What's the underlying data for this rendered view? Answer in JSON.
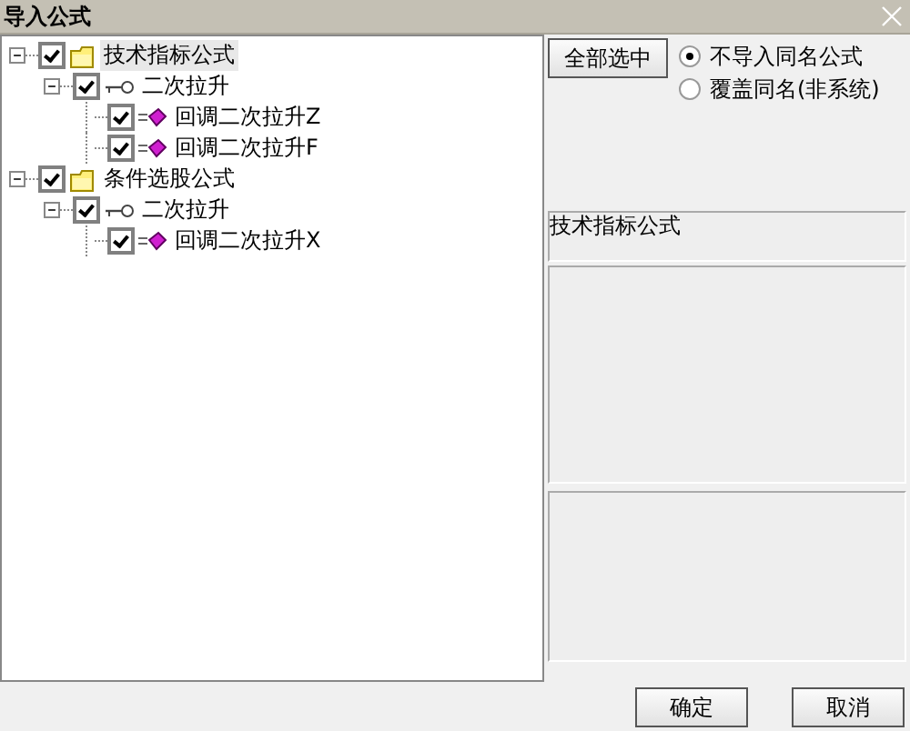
{
  "window": {
    "title": "导入公式"
  },
  "tree": [
    {
      "label": "技术指标公式",
      "kind": "folder",
      "checked": true,
      "expanded": true,
      "selected": true,
      "children": [
        {
          "label": "二次拉升",
          "kind": "group",
          "checked": true,
          "expanded": true,
          "selected": false,
          "children": [
            {
              "label": "回调二次拉升Z",
              "kind": "formula",
              "checked": true,
              "selected": false
            },
            {
              "label": "回调二次拉升F",
              "kind": "formula",
              "checked": true,
              "selected": false
            }
          ]
        }
      ]
    },
    {
      "label": "条件选股公式",
      "kind": "folder",
      "checked": true,
      "expanded": true,
      "selected": false,
      "children": [
        {
          "label": "二次拉升",
          "kind": "group",
          "checked": true,
          "expanded": true,
          "selected": false,
          "children": [
            {
              "label": "回调二次拉升X",
              "kind": "formula",
              "checked": true,
              "selected": false
            }
          ]
        }
      ]
    }
  ],
  "select_all_button": "全部选中",
  "options": [
    {
      "label": "不导入同名公式",
      "selected": true
    },
    {
      "label": "覆盖同名(非系统)",
      "selected": false
    }
  ],
  "info_label": "技术指标公式",
  "buttons": [
    "确定",
    "取消"
  ]
}
